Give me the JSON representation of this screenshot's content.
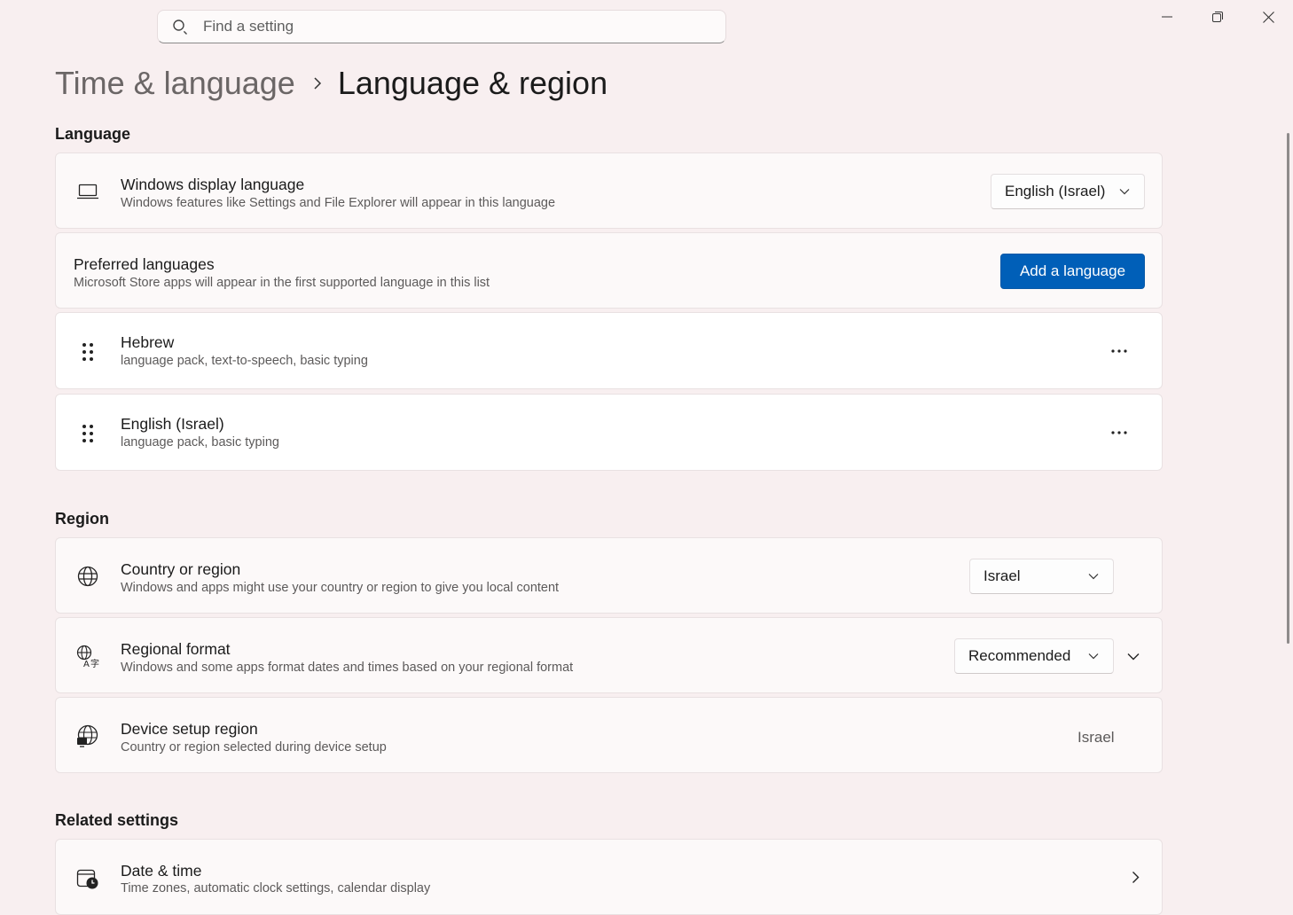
{
  "search": {
    "placeholder": "Find a setting"
  },
  "window_controls": [
    "minimize-icon",
    "restore-icon",
    "close-icon"
  ],
  "breadcrumb": {
    "parent": "Time & language",
    "current": "Language & region"
  },
  "language_section": {
    "heading": "Language",
    "display_language": {
      "title": "Windows display language",
      "desc": "Windows features like Settings and File Explorer will appear in this language",
      "value": "English (Israel)"
    },
    "preferred": {
      "title": "Preferred languages",
      "desc": "Microsoft Store apps will appear in the first supported language in this list",
      "button": "Add a language"
    },
    "languages": [
      {
        "name": "Hebrew",
        "features": "language pack, text-to-speech, basic typing"
      },
      {
        "name": "English (Israel)",
        "features": "language pack, basic typing"
      }
    ]
  },
  "region_section": {
    "heading": "Region",
    "country": {
      "title": "Country or region",
      "desc": "Windows and apps might use your country or region to give you local content",
      "value": "Israel"
    },
    "format": {
      "title": "Regional format",
      "desc": "Windows and some apps format dates and times based on your regional format",
      "value": "Recommended"
    },
    "device_region": {
      "title": "Device setup region",
      "desc": "Country or region selected during device setup",
      "value": "Israel"
    }
  },
  "related_section": {
    "heading": "Related settings",
    "date_time": {
      "title": "Date & time",
      "desc": "Time zones, automatic clock settings, calendar display"
    }
  },
  "colors": {
    "background": "#f8eff0",
    "accent": "#005fb8",
    "card": "#fcf9f9"
  }
}
